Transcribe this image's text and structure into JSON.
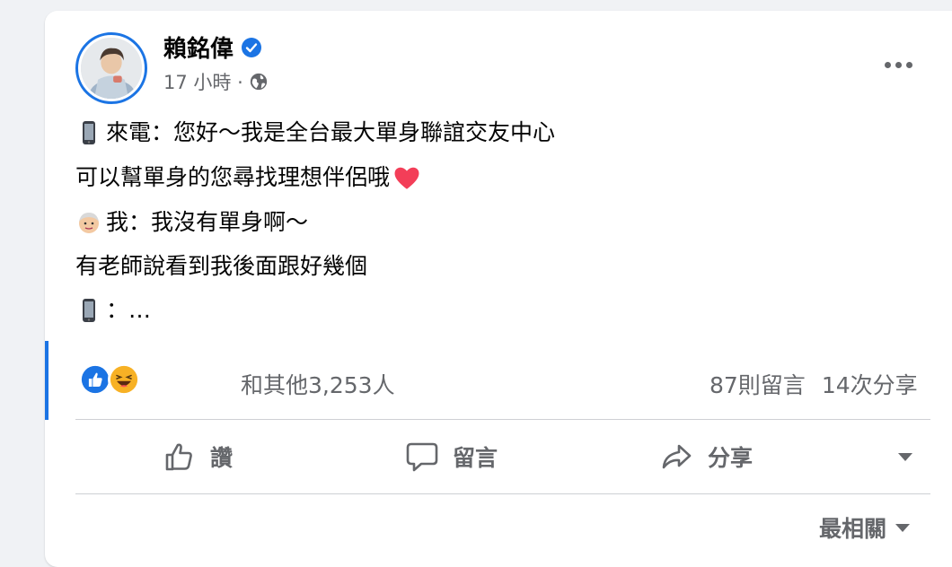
{
  "post": {
    "author": "賴銘偉",
    "time": "17 小時 ·",
    "lines": [
      "來電：您好～我是全台最大單身聯誼交友中心",
      "可以幫單身的您尋找理想伴侶哦",
      "我：我沒有單身啊～",
      "有老師說看到我後面跟好幾個",
      "：…"
    ]
  },
  "engagement": {
    "reaction_count": "和其他3,253人",
    "comments": "87則留言",
    "shares": "14次分享"
  },
  "actions": {
    "like": "讚",
    "comment": "留言",
    "share": "分享"
  },
  "sort": {
    "label": "最相關"
  },
  "icons": {
    "verified": "verified-badge-icon",
    "privacy": "globe-icon",
    "more": "more-icon",
    "phone": "mobile-phone-icon",
    "heart": "red-heart-icon",
    "face": "person-face-icon",
    "like": "thumbs-up-icon",
    "comment": "speech-bubble-icon",
    "share": "share-arrow-icon"
  },
  "colors": {
    "accent": "#1b74e4",
    "text": "#050505",
    "secondary": "#65676b",
    "heart": "#f33e58"
  }
}
